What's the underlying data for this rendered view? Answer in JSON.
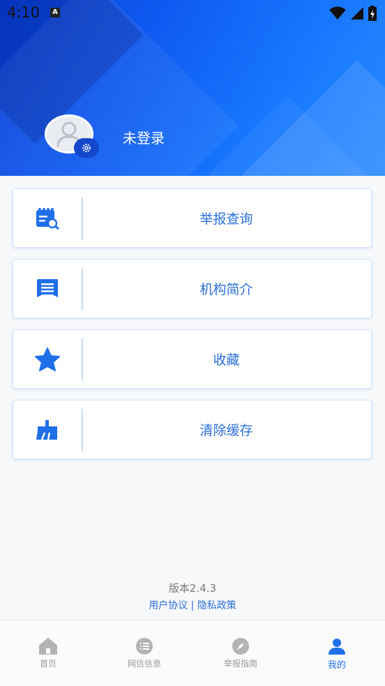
{
  "status_bar": {
    "time": "4:10",
    "notification_icon": "A"
  },
  "profile": {
    "username": "未登录"
  },
  "menu": [
    {
      "label": "举报查询",
      "icon": "calendar-search-icon"
    },
    {
      "label": "机构简介",
      "icon": "message-icon"
    },
    {
      "label": "收藏",
      "icon": "star-icon"
    },
    {
      "label": "清除缓存",
      "icon": "broom-icon"
    }
  ],
  "footer": {
    "version": "版本2.4.3",
    "agreement": "用户协议",
    "separator": "|",
    "privacy": "隐私政策"
  },
  "bottom_nav": [
    {
      "label": "首页",
      "icon": "home-icon"
    },
    {
      "label": "网信信息",
      "icon": "list-icon"
    },
    {
      "label": "举报指南",
      "icon": "compass-icon"
    },
    {
      "label": "我的",
      "icon": "person-icon",
      "active": true
    }
  ],
  "colors": {
    "accent": "#1f6fe8",
    "header_start": "#0a3fd6",
    "header_end": "#2a8bff",
    "inactive": "#9a9a9a"
  }
}
